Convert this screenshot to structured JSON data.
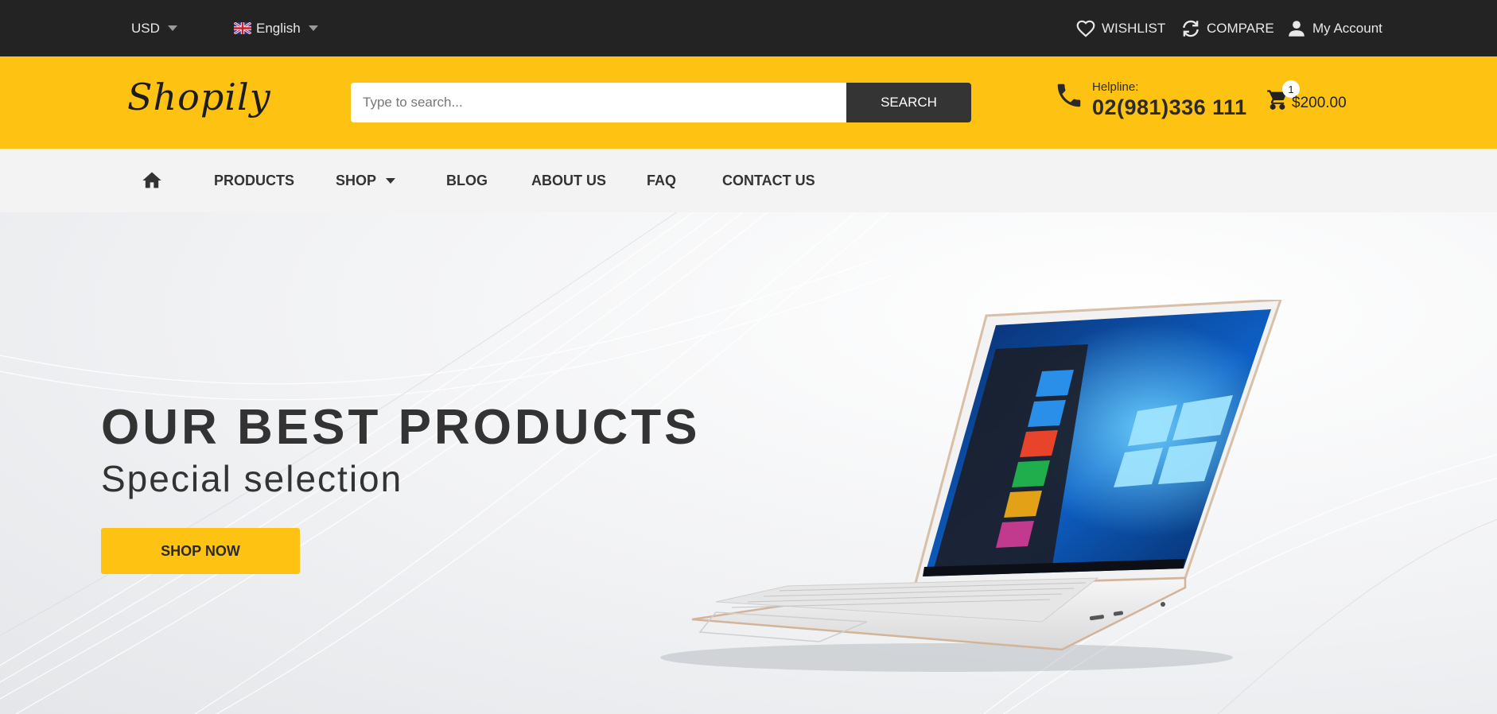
{
  "topbar": {
    "currency": "USD",
    "language": "English",
    "wishlist": "WISHLIST",
    "compare": "COMPARE",
    "account": "My Account"
  },
  "header": {
    "logo": "Shopily",
    "search": {
      "placeholder": "Type to search...",
      "button": "SEARCH"
    },
    "helpline_label": "Helpline:",
    "helpline_number": "02(981)336 111",
    "cart": {
      "count": "1",
      "total": "$200.00"
    }
  },
  "nav": {
    "items": [
      "PRODUCTS",
      "SHOP",
      "BLOG",
      "ABOUT US",
      "FAQ",
      "CONTACT US"
    ]
  },
  "hero": {
    "heading": "OUR BEST PRODUCTS",
    "subheading": "Special selection",
    "button": "SHOP NOW"
  },
  "colors": {
    "topbar_bg": "#232323",
    "accent": "#fec212",
    "nav_bg": "#f3f3f3",
    "search_button": "#343434",
    "text_dark": "#333333"
  },
  "icons": [
    "caret-down-icon",
    "uk-flag-icon",
    "heart-icon",
    "compare-icon",
    "user-icon",
    "phone-icon",
    "cart-icon",
    "home-icon"
  ]
}
